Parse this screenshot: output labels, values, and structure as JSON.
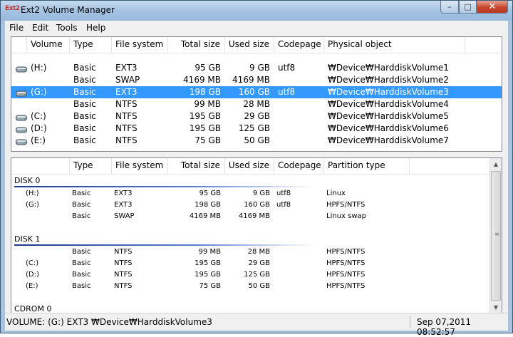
{
  "window": {
    "title": "Ext2 Volume Manager",
    "icon_text": "Ext2",
    "minimize": "–",
    "maximize": "□",
    "close": "✕"
  },
  "menu": [
    "File",
    "Edit",
    "Tools",
    "Help"
  ],
  "top_table": {
    "headers": [
      "Volume",
      "Type",
      "File system",
      "Total size",
      "Used size",
      "Codepage",
      "Physical object"
    ],
    "rows": [
      {
        "volume": "(H:)",
        "type": "Basic",
        "fs": "EXT3",
        "total": "95 GB",
        "used": "9 GB",
        "codepage": "utf8",
        "physical": "₩Device₩HarddiskVolume1",
        "selected": false,
        "icon": true
      },
      {
        "volume": "",
        "type": "Basic",
        "fs": "SWAP",
        "total": "4169 MB",
        "used": "4169 MB",
        "codepage": "",
        "physical": "₩Device₩HarddiskVolume2",
        "selected": false,
        "icon": false
      },
      {
        "volume": "(G:)",
        "type": "Basic",
        "fs": "EXT3",
        "total": "198 GB",
        "used": "160 GB",
        "codepage": "utf8",
        "physical": "₩Device₩HarddiskVolume3",
        "selected": true,
        "icon": true
      },
      {
        "volume": "",
        "type": "Basic",
        "fs": "NTFS",
        "total": "99 MB",
        "used": "28 MB",
        "codepage": "",
        "physical": "₩Device₩HarddiskVolume4",
        "selected": false,
        "icon": false
      },
      {
        "volume": "(C:)",
        "type": "Basic",
        "fs": "NTFS",
        "total": "195 GB",
        "used": "29 GB",
        "codepage": "",
        "physical": "₩Device₩HarddiskVolume5",
        "selected": false,
        "icon": true
      },
      {
        "volume": "(D:)",
        "type": "Basic",
        "fs": "NTFS",
        "total": "195 GB",
        "used": "125 GB",
        "codepage": "",
        "physical": "₩Device₩HarddiskVolume6",
        "selected": false,
        "icon": true
      },
      {
        "volume": "(E:)",
        "type": "Basic",
        "fs": "NTFS",
        "total": "75 GB",
        "used": "50 GB",
        "codepage": "",
        "physical": "₩Device₩HarddiskVolume7",
        "selected": false,
        "icon": true
      }
    ]
  },
  "bottom_table": {
    "headers": [
      "",
      "Type",
      "File system",
      "Total size",
      "Used size",
      "Codepage",
      "Partition type"
    ],
    "disks": [
      {
        "label": "DISK 0",
        "rows": [
          {
            "volume": "(H:)",
            "type": "Basic",
            "fs": "EXT3",
            "total": "95 GB",
            "used": "9 GB",
            "codepage": "utf8",
            "ptype": "Linux"
          },
          {
            "volume": "(G:)",
            "type": "Basic",
            "fs": "EXT3",
            "total": "198 GB",
            "used": "160 GB",
            "codepage": "utf8",
            "ptype": "HPFS/NTFS"
          },
          {
            "volume": "",
            "type": "Basic",
            "fs": "SWAP",
            "total": "4169 MB",
            "used": "4169 MB",
            "codepage": "",
            "ptype": "Linux swap"
          }
        ]
      },
      {
        "label": "DISK 1",
        "rows": [
          {
            "volume": "",
            "type": "Basic",
            "fs": "NTFS",
            "total": "99 MB",
            "used": "28 MB",
            "codepage": "",
            "ptype": "HPFS/NTFS"
          },
          {
            "volume": "(C:)",
            "type": "Basic",
            "fs": "NTFS",
            "total": "195 GB",
            "used": "29 GB",
            "codepage": "",
            "ptype": "HPFS/NTFS"
          },
          {
            "volume": "(D:)",
            "type": "Basic",
            "fs": "NTFS",
            "total": "195 GB",
            "used": "125 GB",
            "codepage": "",
            "ptype": "HPFS/NTFS"
          },
          {
            "volume": "(E:)",
            "type": "Basic",
            "fs": "NTFS",
            "total": "75 GB",
            "used": "50 GB",
            "codepage": "",
            "ptype": "HPFS/NTFS"
          }
        ]
      },
      {
        "label": "CDROM 0",
        "rows": []
      }
    ]
  },
  "scrollbar": {
    "up": "▲",
    "down": "▼",
    "grip": "≡"
  },
  "status": {
    "left": "VOLUME: (G:) EXT3 ₩Device₩HarddiskVolume3",
    "right": "Sep 07,2011 08:52:57"
  },
  "colors": {
    "selection": "#3399ff",
    "window_frame": "#a9c3df",
    "close_button": "#c7462c"
  }
}
